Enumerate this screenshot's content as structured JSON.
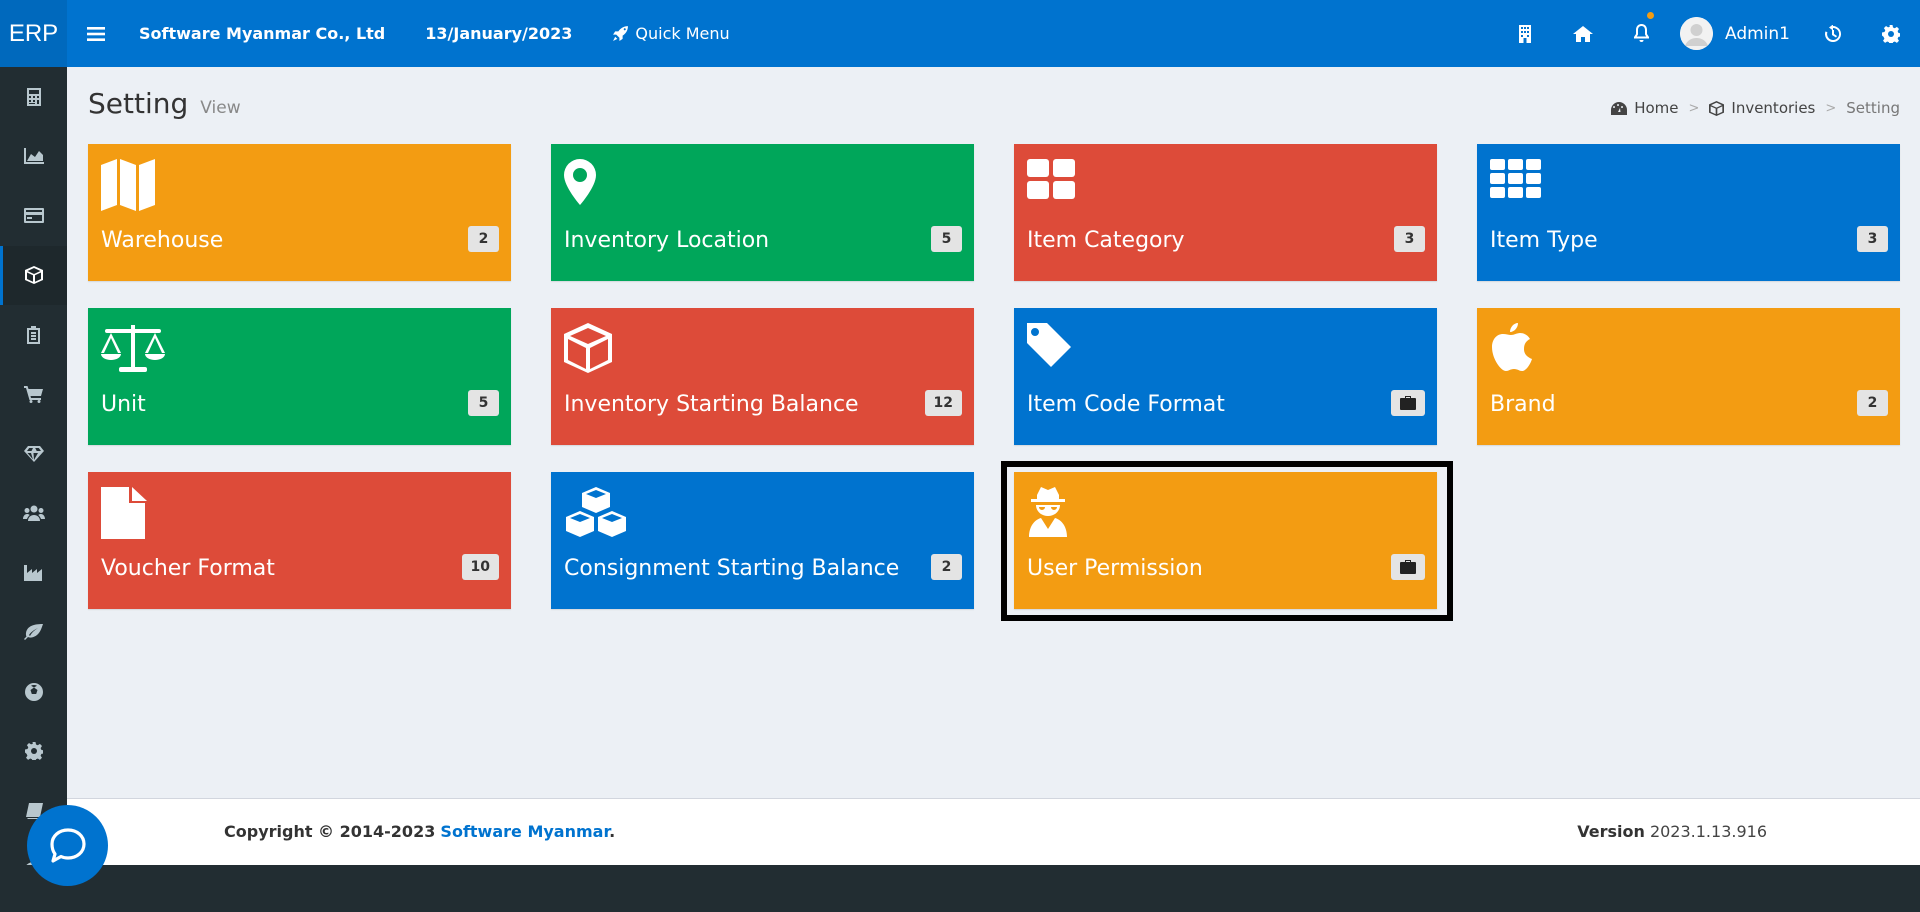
{
  "header": {
    "logo": "ERP",
    "company": "Software Myanmar Co., Ltd",
    "date": "13/January/2023",
    "quick_menu": "Quick Menu",
    "username": "Admin1"
  },
  "page": {
    "title": "Setting",
    "subtitle": "View"
  },
  "breadcrumb": {
    "home": "Home",
    "inventories": "Inventories",
    "current": "Setting",
    "separator": ">"
  },
  "tiles": [
    {
      "label": "Warehouse",
      "badge": "2",
      "color": "#f39c12",
      "icon": "map-icon"
    },
    {
      "label": "Inventory Location",
      "badge": "5",
      "color": "#00a65a",
      "icon": "map-marker-icon"
    },
    {
      "label": "Item Category",
      "badge": "3",
      "color": "#dd4b39",
      "icon": "grid-large-icon"
    },
    {
      "label": "Item Type",
      "badge": "3",
      "color": "#0073cf",
      "icon": "grid-small-icon"
    },
    {
      "label": "Unit",
      "badge": "5",
      "color": "#00a65a",
      "icon": "balance-scale-icon"
    },
    {
      "label": "Inventory Starting Balance",
      "badge": "12",
      "color": "#dd4b39",
      "icon": "cube-icon"
    },
    {
      "label": "Item Code Format",
      "badge": "",
      "color": "#0073cf",
      "icon": "tag-icon"
    },
    {
      "label": "Brand",
      "badge": "2",
      "color": "#f39c12",
      "icon": "apple-icon"
    },
    {
      "label": "Voucher Format",
      "badge": "10",
      "color": "#dd4b39",
      "icon": "file-icon"
    },
    {
      "label": "Consignment Starting Balance",
      "badge": "2",
      "color": "#0073cf",
      "icon": "cubes-icon"
    },
    {
      "label": "User Permission",
      "badge": "",
      "color": "#f39c12",
      "icon": "user-secret-icon"
    }
  ],
  "footer": {
    "copyright_prefix": "Copyright © 2014-2023",
    "company_link": "Software Myanmar",
    "period": ".",
    "version_label": "Version",
    "version": "2023.1.13.916"
  },
  "sidebar": {
    "items": [
      "calculator-icon",
      "area-chart-icon",
      "credit-card-icon",
      "cube-icon",
      "clipboard-icon",
      "shopping-cart-icon",
      "diamond-icon",
      "users-icon",
      "industry-icon",
      "leaf-icon",
      "soccer-ball-icon",
      "cog-icon",
      "book-icon",
      "comment-icon"
    ],
    "active_index": 3
  },
  "colors": {
    "primary": "#0073cf",
    "sidebar": "#222d32",
    "orange": "#f39c12",
    "green": "#00a65a",
    "red": "#dd4b39"
  }
}
